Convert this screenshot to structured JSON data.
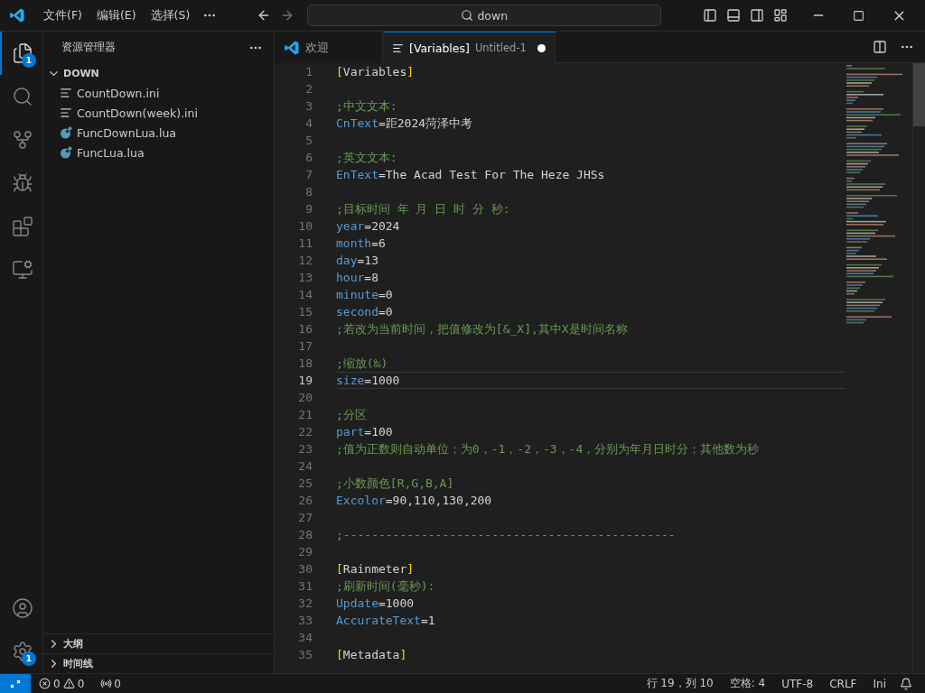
{
  "title_bar": {
    "menus": [
      "文件(F)",
      "编辑(E)",
      "选择(S)"
    ],
    "search": {
      "value": "down"
    }
  },
  "activity_bar": {
    "items": [
      {
        "kind": "explorer",
        "selected": true,
        "badge": "1"
      },
      {
        "kind": "search",
        "selected": false
      },
      {
        "kind": "source-control",
        "selected": false
      },
      {
        "kind": "run",
        "selected": false
      },
      {
        "kind": "extensions",
        "selected": false
      },
      {
        "kind": "remote",
        "selected": false
      }
    ],
    "bottom": [
      {
        "kind": "account"
      },
      {
        "kind": "settings",
        "badge": "1"
      }
    ]
  },
  "sidebar": {
    "title": "资源管理器",
    "folder": {
      "name": "DOWN",
      "expanded": true,
      "children": [
        {
          "name": "CountDown.ini",
          "kind": "ini"
        },
        {
          "name": "CountDown(week).ini",
          "kind": "ini"
        },
        {
          "name": "FuncDownLua.lua",
          "kind": "lua"
        },
        {
          "name": "FuncLua.lua",
          "kind": "lua"
        }
      ]
    },
    "panels": [
      {
        "label": "大纲",
        "expanded": false
      },
      {
        "label": "时间线",
        "expanded": false
      }
    ]
  },
  "tabs": [
    {
      "label": "欢迎",
      "kind": "welcome",
      "selected": false
    },
    {
      "label": "[Variables]",
      "description": "Untitled-1",
      "kind": "text",
      "selected": true,
      "dirty": true
    }
  ],
  "editor": {
    "lines": [
      {
        "n": "1",
        "kind": "section",
        "open": "[",
        "name": "Variables",
        "close": "]",
        "current": false
      },
      {
        "n": "2",
        "kind": "empty",
        "current": false
      },
      {
        "n": "3",
        "kind": "comment",
        "text": ";中文文本:",
        "current": false
      },
      {
        "n": "4",
        "kind": "pair",
        "key": "CnText",
        "value": "=距2024菏泽中考",
        "current": false
      },
      {
        "n": "5",
        "kind": "empty",
        "current": false
      },
      {
        "n": "6",
        "kind": "comment",
        "text": ";英文文本:",
        "current": false
      },
      {
        "n": "7",
        "kind": "pair",
        "key": "EnText",
        "value": "=The Acad Test For The Heze JHSs",
        "current": false
      },
      {
        "n": "8",
        "kind": "empty",
        "current": false
      },
      {
        "n": "9",
        "kind": "comment",
        "text": ";目标时间 年 月 日 时 分 秒:",
        "current": false
      },
      {
        "n": "10",
        "kind": "pair",
        "key": "year",
        "value": "=2024",
        "current": false
      },
      {
        "n": "11",
        "kind": "pair",
        "key": "month",
        "value": "=6",
        "current": false
      },
      {
        "n": "12",
        "kind": "pair",
        "key": "day",
        "value": "=13",
        "current": false
      },
      {
        "n": "13",
        "kind": "pair",
        "key": "hour",
        "value": "=8",
        "current": false
      },
      {
        "n": "14",
        "kind": "pair",
        "key": "minute",
        "value": "=0",
        "current": false
      },
      {
        "n": "15",
        "kind": "pair",
        "key": "second",
        "value": "=0",
        "current": false
      },
      {
        "n": "16",
        "kind": "comment",
        "text": ";若改为当前时间，把值修改为[&_X],其中X是时间名称",
        "current": false
      },
      {
        "n": "17",
        "kind": "empty",
        "current": false
      },
      {
        "n": "18",
        "kind": "comment",
        "text": ";缩放(‰)",
        "current": false
      },
      {
        "n": "19",
        "kind": "pair",
        "key": "size",
        "value": "=1000",
        "current": true
      },
      {
        "n": "20",
        "kind": "empty",
        "current": false
      },
      {
        "n": "21",
        "kind": "comment",
        "text": ";分区",
        "current": false
      },
      {
        "n": "22",
        "kind": "pair",
        "key": "part",
        "value": "=100",
        "current": false
      },
      {
        "n": "23",
        "kind": "comment",
        "text": ";值为正数则自动单位；为0，-1，-2，-3，-4，分别为年月日时分；其他数为秒",
        "current": false
      },
      {
        "n": "24",
        "kind": "empty",
        "current": false
      },
      {
        "n": "25",
        "kind": "comment",
        "text": ";小数颜色[R,G,B,A]",
        "current": false
      },
      {
        "n": "26",
        "kind": "pair",
        "key": "Excolor",
        "value": "=90,110,130,200",
        "current": false
      },
      {
        "n": "27",
        "kind": "empty",
        "current": false
      },
      {
        "n": "28",
        "kind": "comment",
        "text": ";-----------------------------------------------",
        "current": false
      },
      {
        "n": "29",
        "kind": "empty",
        "current": false
      },
      {
        "n": "30",
        "kind": "section",
        "open": "[",
        "name": "Rainmeter",
        "close": "]",
        "current": false
      },
      {
        "n": "31",
        "kind": "comment",
        "text": ";刷新时间(毫秒):",
        "current": false
      },
      {
        "n": "32",
        "kind": "pair",
        "key": "Update",
        "value": "=1000",
        "current": false
      },
      {
        "n": "33",
        "kind": "pair",
        "key": "AccurateText",
        "value": "=1",
        "current": false
      },
      {
        "n": "34",
        "kind": "empty",
        "current": false
      },
      {
        "n": "35",
        "kind": "section",
        "open": "[",
        "name": "Metadata",
        "close": "]",
        "current": false
      }
    ]
  },
  "status_bar": {
    "errors": "0",
    "warnings": "0",
    "ports": "0",
    "items": [
      "行 19，列 10",
      "空格: 4",
      "UTF-8",
      "CRLF",
      "Ini"
    ]
  }
}
